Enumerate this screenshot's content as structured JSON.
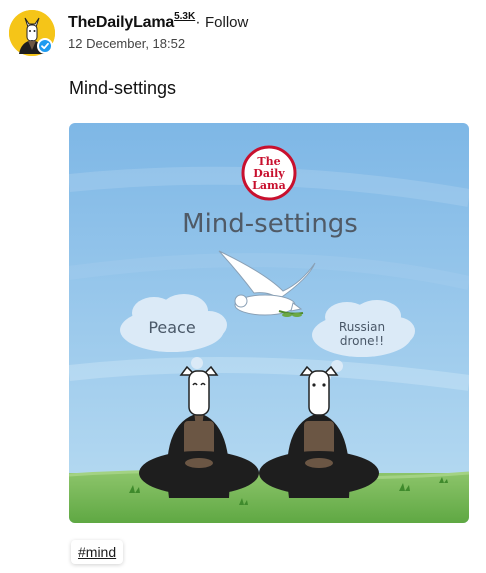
{
  "author": {
    "name": "TheDailyLama",
    "followers": "5.3K",
    "separator": "·",
    "follow_label": "Follow",
    "avatar_icon": "llama-avatar-icon",
    "verified_icon": "verified-badge-icon"
  },
  "post": {
    "date": "12 December, 18:52",
    "title": "Mind-settings",
    "hashtag": "#mind"
  },
  "illustration": {
    "logo_line1": "The",
    "logo_line2": "Daily",
    "logo_line3": "Lama",
    "title": "Mind-settings",
    "cloud_left": "Peace",
    "cloud_right_line1": "Russian",
    "cloud_right_line2": "drone!!"
  },
  "colors": {
    "sky_top": "#7eb7e6",
    "sky_bottom": "#b9dcf2",
    "grass": "#6fb34f",
    "robe": "#1e1e1e",
    "apron": "#6b5644",
    "logo_red": "#c8102e",
    "avatar_bg": "#f5c518",
    "verified": "#1d9bf0"
  }
}
